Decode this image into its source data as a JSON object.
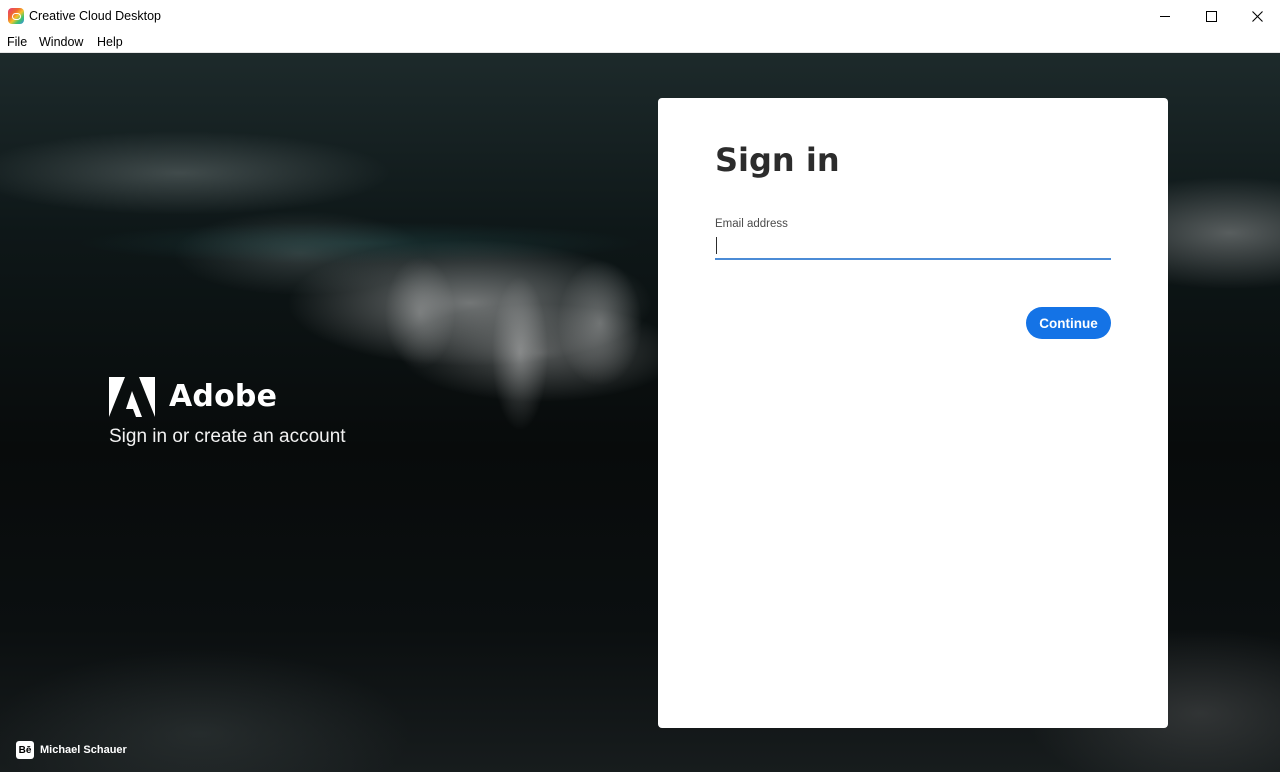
{
  "window": {
    "title": "Creative Cloud Desktop",
    "controls": [
      "minimize",
      "maximize",
      "close"
    ]
  },
  "menu": {
    "file": "File",
    "window": "Window",
    "help": "Help"
  },
  "branding": {
    "logo_text": "Adobe",
    "subtitle": "Sign in or create an account"
  },
  "signin": {
    "title": "Sign in",
    "email_label": "Email address",
    "email_value": "",
    "continue_label": "Continue"
  },
  "credit": {
    "icon": "Bē",
    "name": "Michael Schauer"
  },
  "colors": {
    "accent": "#1473e6",
    "input_underline": "#4b8bd6",
    "card": "#ffffff",
    "title_text": "#2c2c2c"
  },
  "icons": {
    "app": "creative-cloud-icon",
    "logo": "adobe-logo-icon",
    "credit": "behance-icon",
    "close": "close-icon"
  }
}
